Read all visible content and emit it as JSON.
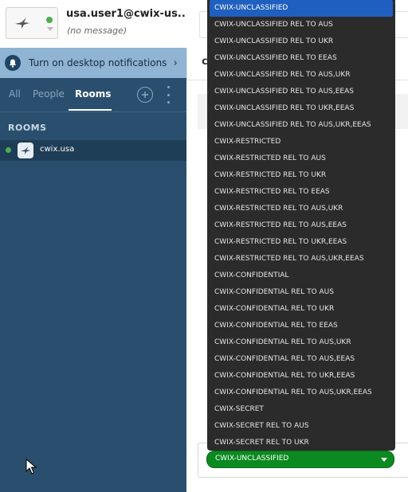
{
  "account": {
    "name": "usa.user1@cwix-us...",
    "status_message": "(no message)"
  },
  "sidebar": {
    "notification": {
      "text": "Turn on desktop notifications"
    },
    "tabs": [
      {
        "label": "All"
      },
      {
        "label": "People"
      },
      {
        "label": "Rooms"
      }
    ],
    "active_tab": "Rooms",
    "rooms_header": "ROOMS",
    "rooms": [
      {
        "name": "cwix.usa"
      }
    ]
  },
  "main": {
    "band_char": "c"
  },
  "classification": {
    "selected": "CWIX-UNCLASSIFIED",
    "options": [
      "CWIX-UNCLASSIFIED",
      "CWIX-UNCLASSIFIED REL TO AUS",
      "CWIX-UNCLASSIFIED REL TO UKR",
      "CWIX-UNCLASSIFIED REL TO EEAS",
      "CWIX-UNCLASSIFIED REL TO AUS,UKR",
      "CWIX-UNCLASSIFIED REL TO AUS,EEAS",
      "CWIX-UNCLASSIFIED REL TO UKR,EEAS",
      "CWIX-UNCLASSIFIED REL TO AUS,UKR,EEAS",
      "CWIX-RESTRICTED",
      "CWIX-RESTRICTED REL TO AUS",
      "CWIX-RESTRICTED REL TO UKR",
      "CWIX-RESTRICTED REL TO EEAS",
      "CWIX-RESTRICTED REL TO AUS,UKR",
      "CWIX-RESTRICTED REL TO AUS,EEAS",
      "CWIX-RESTRICTED REL TO UKR,EEAS",
      "CWIX-RESTRICTED REL TO AUS,UKR,EEAS",
      "CWIX-CONFIDENTIAL",
      "CWIX-CONFIDENTIAL REL TO AUS",
      "CWIX-CONFIDENTIAL REL TO UKR",
      "CWIX-CONFIDENTIAL REL TO EEAS",
      "CWIX-CONFIDENTIAL REL TO AUS,UKR",
      "CWIX-CONFIDENTIAL REL TO AUS,EEAS",
      "CWIX-CONFIDENTIAL REL TO UKR,EEAS",
      "CWIX-CONFIDENTIAL REL TO AUS,UKR,EEAS",
      "CWIX-SECRET",
      "CWIX-SECRET REL TO AUS",
      "CWIX-SECRET REL TO UKR"
    ]
  },
  "icons": {
    "avatar": "swift-bird-icon",
    "bell": "bell-icon",
    "chevron": "chevron-right-icon",
    "add": "plus-circle-icon",
    "more": "more-vertical-icon",
    "select_arrow": "caret-down-icon",
    "cursor": "mouse-pointer-icon"
  },
  "colors": {
    "sidebar_bg": "#2a4f6e",
    "notify_bg": "#8fb4d4",
    "dropdown_bg": "#2b2b2b",
    "selected_option": "#1f5fbf",
    "select_green": "#0b8a1f",
    "presence_online": "#4caf50"
  }
}
